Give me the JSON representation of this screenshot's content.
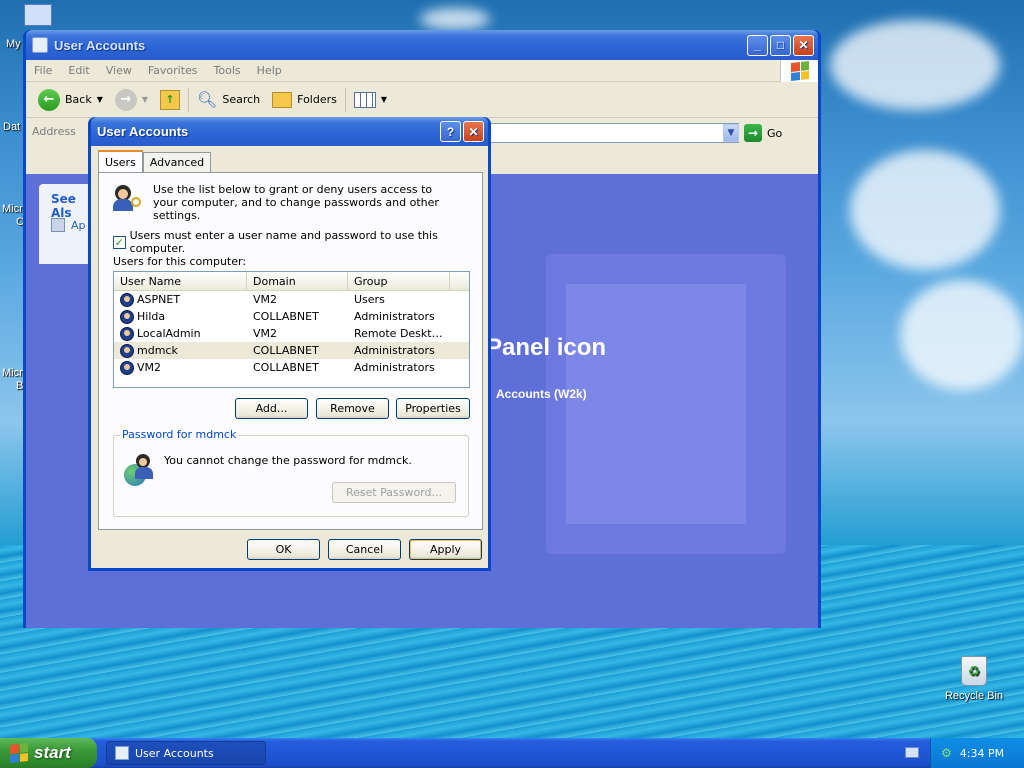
{
  "desktop": {
    "icons": [
      {
        "name": "my-computer",
        "label": "My"
      },
      {
        "name": "data",
        "label": "Dat"
      },
      {
        "name": "microsoft-1",
        "label": "Micro",
        "label2": "C"
      },
      {
        "name": "microsoft-2",
        "label": "Micro",
        "label2": "B"
      }
    ],
    "recycle_bin": "Recycle Bin"
  },
  "explorer": {
    "title": "User Accounts",
    "menu": [
      "File",
      "Edit",
      "View",
      "Favorites",
      "Tools",
      "Help"
    ],
    "toolbar": {
      "back": "Back",
      "search": "Search",
      "folders": "Folders"
    },
    "address_label": "Address",
    "go_label": "Go",
    "see_also_title": "See Als",
    "see_also_item": "Ap",
    "panel_heading": "Panel icon",
    "panel_sub": "Accounts (W2k)"
  },
  "dialog": {
    "title": "User Accounts",
    "tabs": [
      "Users",
      "Advanced"
    ],
    "intro_text": "Use the list below to grant or deny users access to your computer, and to change passwords and other settings.",
    "must_login_label": "Users must enter a user name and password to use this computer.",
    "must_login_checked": true,
    "users_label": "Users for this computer:",
    "columns": [
      "User Name",
      "Domain",
      "Group"
    ],
    "users": [
      {
        "name": "ASPNET",
        "domain": "VM2",
        "group": "Users"
      },
      {
        "name": "Hilda",
        "domain": "COLLABNET",
        "group": "Administrators"
      },
      {
        "name": "LocalAdmin",
        "domain": "VM2",
        "group": "Remote Deskto..."
      },
      {
        "name": "mdmck",
        "domain": "COLLABNET",
        "group": "Administrators"
      },
      {
        "name": "VM2",
        "domain": "COLLABNET",
        "group": "Administrators"
      }
    ],
    "selected_user": "mdmck",
    "buttons": {
      "add": "Add...",
      "remove": "Remove",
      "properties": "Properties"
    },
    "password_group": "Password for mdmck",
    "password_msg": "You cannot change the password for mdmck.",
    "reset_password": "Reset Password...",
    "ok": "OK",
    "cancel": "Cancel",
    "apply": "Apply"
  },
  "taskbar": {
    "start": "start",
    "task": "User Accounts",
    "clock": "4:34 PM"
  }
}
